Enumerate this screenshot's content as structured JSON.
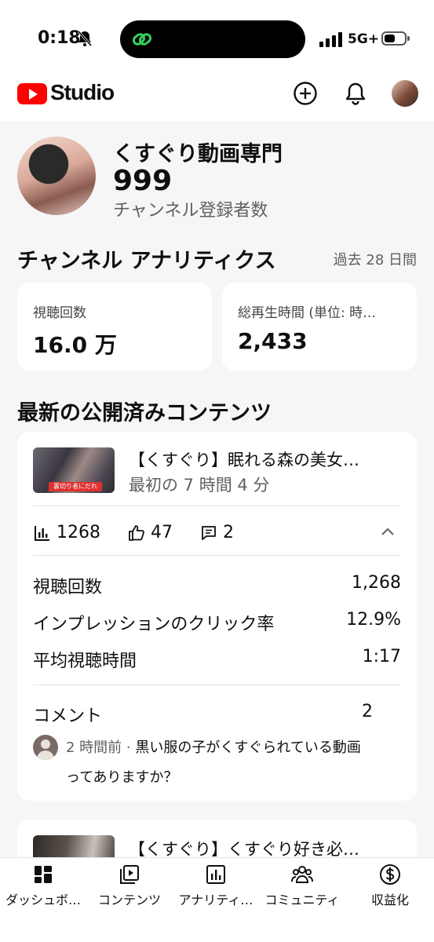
{
  "status_bar": {
    "time": "0:18",
    "network": "5G+",
    "battery_level": 0.55
  },
  "header": {
    "logo_text": "Studio",
    "icons": [
      "add-circle-icon",
      "bell-icon",
      "avatar"
    ]
  },
  "channel": {
    "name": "くすぐり動画専門",
    "subscriber_count": "999",
    "subscriber_label": "チャンネル登録者数"
  },
  "analytics": {
    "title": "チャンネル アナリティクス",
    "period": "過去 28 日間",
    "stats": [
      {
        "label": "視聴回数",
        "value": "16.0 万"
      },
      {
        "label": "総再生時間 (単位: 時…",
        "value": "2,433"
      }
    ]
  },
  "latest": {
    "title": "最新の公開済みコンテンツ",
    "video": {
      "thumbnail_badge": "裏切り者にだれか?",
      "title": "【くすぐり】眠れる森の美女…",
      "time": "最初の 7 時間 4 分",
      "views": "1268",
      "likes": "47",
      "comments": "2",
      "rows": [
        {
          "label": "視聴回数",
          "value": "1,268"
        },
        {
          "label": "インプレッションのクリック率",
          "value": "12.9%"
        },
        {
          "label": "平均視聴時間",
          "value": "1:17"
        }
      ],
      "comments_section": {
        "label": "コメント",
        "count": "2",
        "comment_time": "2 時間前",
        "comment_text_1": "黒い服の子がくすぐられている動画",
        "comment_text_2": "ってありますか？"
      }
    },
    "next_video": {
      "title": "【くすぐり】くすぐり好き必…"
    }
  },
  "bottom_nav": [
    {
      "label": "ダッシュボ…",
      "icon": "dashboard-icon"
    },
    {
      "label": "コンテンツ",
      "icon": "content-icon"
    },
    {
      "label": "アナリティ…",
      "icon": "analytics-icon"
    },
    {
      "label": "コミュニティ",
      "icon": "community-icon"
    },
    {
      "label": "収益化",
      "icon": "monetization-icon"
    }
  ]
}
